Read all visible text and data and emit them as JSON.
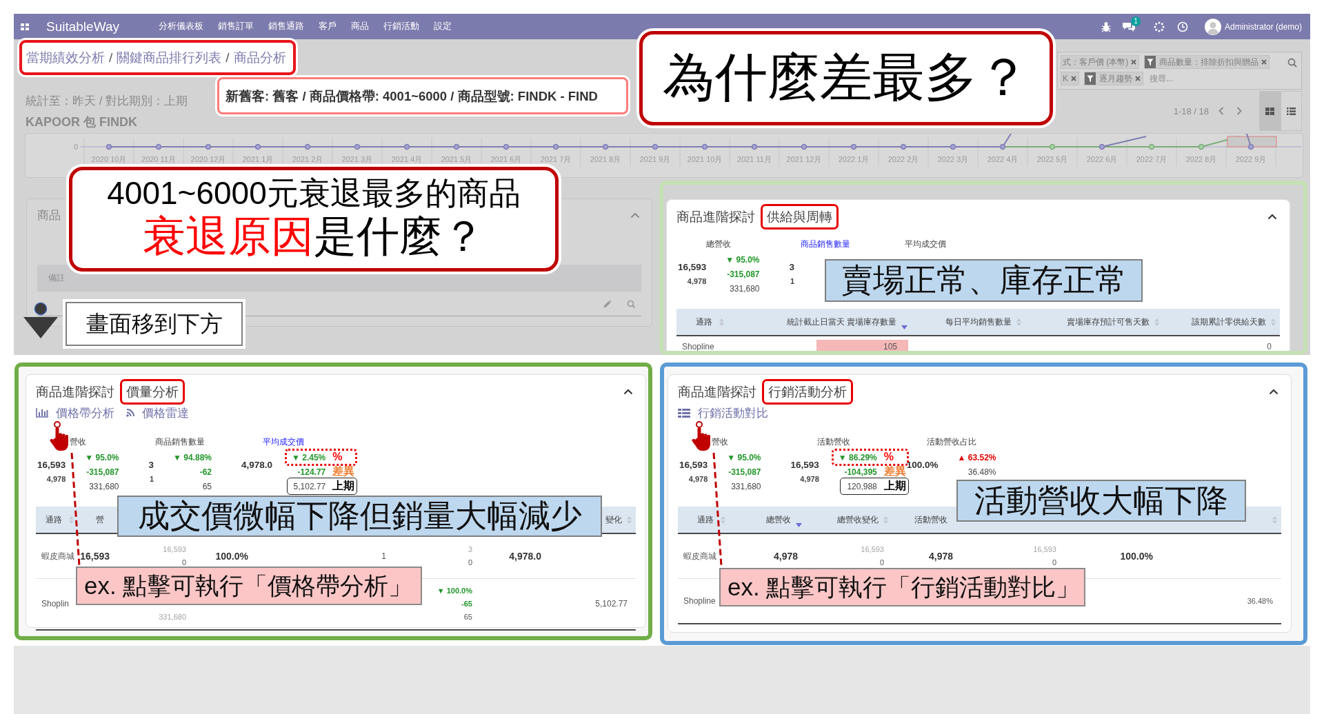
{
  "nav": {
    "brand": "SuitableWay",
    "menu": [
      "分析儀表板",
      "銷售訂單",
      "銷售通路",
      "客戶",
      "商品",
      "行銷活動",
      "設定"
    ],
    "message_count": "1",
    "user": "Administrator (demo)"
  },
  "breadcrumb": [
    {
      "kind": "link",
      "text": "當期績效分析"
    },
    {
      "kind": "separator",
      "text": "/"
    },
    {
      "kind": "link",
      "text": "關鍵商品排行列表"
    },
    {
      "kind": "separator",
      "text": "/"
    },
    {
      "kind": "link",
      "text": "商品分析"
    }
  ],
  "period": "統計至：昨天 / 對比期別：上期",
  "filter_callout": "新舊客: 舊客 / 商品價格帶: 4001~6000 / 商品型號: FINDK - FIND",
  "record_title": "KAPOOR 包 FINDK",
  "question_callout": "為什麼差最多？",
  "search": {
    "facets": [
      {
        "text": "式：客戶價 (本幣)",
        "filter_icon": false
      },
      {
        "text": "商品數量：排除折扣與贈品",
        "filter_icon": true
      },
      {
        "text": "K",
        "filter_icon": false
      },
      {
        "text": "逐月趨勢",
        "filter_icon": true
      }
    ],
    "placeholder": "搜尋..."
  },
  "pager": "1-18 / 18",
  "views": [
    {
      "kind": "kanban",
      "selected": true
    },
    {
      "kind": "list",
      "selected": false
    }
  ],
  "trend_chart": {
    "y_tick": "0",
    "x_labels": [
      "2020 10月",
      "2020 11月",
      "2020 12月",
      "2021 1月",
      "2021 2月",
      "2021 3月",
      "2021 4月",
      "2021 5月",
      "2021 6月",
      "2021 7月",
      "2021 8月",
      "2021 9月",
      "2021 10月",
      "2021 11月",
      "2021 12月",
      "2022 1月",
      "2022 2月",
      "2022 3月",
      "2022 4月",
      "2022 5月",
      "2022 6月",
      "2022 7月",
      "2022 8月",
      "2022 9月"
    ]
  },
  "decline_callout": {
    "line_1": "4001~6000元衰退最多的商品",
    "line_2_highlight": "衰退原因",
    "line_2_rest": "是什麼？"
  },
  "detail_card": {
    "title": "商品",
    "column": "備註"
  },
  "scroll_callout": "畫面移到下方",
  "panels": [
    {
      "color": "#c5e0b4",
      "title": "商品進階探討",
      "section": "供給與周轉",
      "kpis": [
        {
          "label": "總營收",
          "selected": false,
          "value": "16,593",
          "sub_value": "4,978",
          "lines": [
            {
              "text": "▼ 95.0%",
              "kind": "down"
            },
            {
              "text": "-315,087",
              "kind": "down"
            },
            {
              "text": "331,680",
              "kind": "plain"
            }
          ]
        },
        {
          "label": "商品銷售數量",
          "selected": true,
          "value": "3",
          "sub_value": "1"
        },
        {
          "label": "平均成交價",
          "selected": false
        }
      ],
      "callout": "賣場正常、庫存正常",
      "table": {
        "header": {
          "column_1": {
            "label": "通路",
            "sortable": true,
            "sorted": false
          },
          "column_2": {
            "label": "統計截止日當天 賣場庫存數量",
            "sorted": true
          },
          "column_3": {
            "label": "每日平均銷售數量",
            "sortable": true,
            "sorted": false
          },
          "column_4": {
            "label": "賣場庫存預計可售天數",
            "sortable": true,
            "sorted": false
          },
          "column_5": {
            "label": "該期累計零供給天數",
            "sortable": true,
            "sorted": false
          }
        },
        "rows": [
          {
            "column_1": [
              {
                "text": "Shopline",
                "kind": "plain"
              }
            ],
            "column_2": [
              {
                "text": "105",
                "kind": "bar"
              }
            ],
            "column_5": [
              {
                "text": "0",
                "kind": "plain"
              }
            ]
          }
        ]
      }
    },
    {
      "color": "#70ad47",
      "title": "商品進階探討",
      "section": "價量分析",
      "links": [
        {
          "kind": "bars",
          "label": "價格帶分析",
          "pointed": true
        },
        {
          "kind": "feed",
          "label": "價格雷達",
          "pointed": false
        }
      ],
      "kpis": [
        {
          "label": "營收",
          "selected": false,
          "value": "16,593",
          "sub_value": "4,978",
          "lines": [
            {
              "text": "▼ 95.0%",
              "kind": "down"
            },
            {
              "text": "-315,087",
              "kind": "down"
            },
            {
              "text": "331,680",
              "kind": "plain"
            }
          ]
        },
        {
          "label": "商品銷售數量",
          "selected": false,
          "value": "3",
          "sub_value": "1",
          "lines": [
            {
              "text": "▼ 94.88%",
              "kind": "down"
            },
            {
              "text": "-62",
              "kind": "down"
            },
            {
              "text": "65",
              "kind": "plain"
            }
          ]
        },
        {
          "label": "平均成交價",
          "selected": true,
          "value": "4,978.0",
          "lines": [
            {
              "text": "▼ 2.45%",
              "kind": "down",
              "frame": {
                "kind": "dotted"
              },
              "note": {
                "text": "%",
                "color": "#ff0000"
              }
            },
            {
              "text": "-124.77",
              "kind": "down",
              "note": {
                "text": "差異",
                "color": "#ed7d31"
              }
            },
            {
              "text": "5,102.77",
              "kind": "plain",
              "frame": {
                "kind": "solid"
              },
              "note": {
                "text": "上期",
                "color": "#000000"
              }
            }
          ]
        }
      ],
      "callout": "成交價微幅下降但銷量大幅減少",
      "table": {
        "header": {
          "column_1": {
            "label": "通路",
            "sortable": true,
            "sorted": false
          },
          "column_2": {
            "label": "營"
          },
          "column_8": {
            "label": "變化",
            "sortable": true,
            "sorted": false
          }
        },
        "rows": [
          {
            "column_1": [
              {
                "text": "蝦皮商城",
                "kind": "plain"
              }
            ],
            "column_2": [
              {
                "text": "16,593",
                "kind": "strong"
              }
            ],
            "column_3": [
              {
                "text": "16,593",
                "kind": "faint"
              },
              {
                "text": "0",
                "kind": "small"
              }
            ],
            "column_4": [
              {
                "text": "100.0%",
                "kind": "strong"
              }
            ],
            "column_5": [
              {
                "text": "1",
                "kind": "plain"
              }
            ],
            "column_6": [
              {
                "text": "3",
                "kind": "faint"
              },
              {
                "text": "0",
                "kind": "small"
              }
            ],
            "column_7": [
              {
                "text": "4,978.0",
                "kind": "strong"
              }
            ]
          },
          {
            "column_1": [
              {
                "text": "Shoplin",
                "kind": "plain"
              }
            ],
            "column_3": [
              {
                "text": "331,680",
                "kind": "faint"
              }
            ],
            "column_6": [
              {
                "text": "▼ 100.0%",
                "kind": "down"
              },
              {
                "text": "-65",
                "kind": "down"
              },
              {
                "text": "65",
                "kind": "small"
              }
            ],
            "column_8": [
              {
                "text": "5,102.77",
                "kind": "plain"
              }
            ]
          }
        ]
      },
      "hint": "ex. 點擊可執行「價格帶分析」"
    },
    {
      "color": "#5b9bd5",
      "title": "商品進階探討",
      "section": "行銷活動分析",
      "links": [
        {
          "kind": "list",
          "label": "行銷活動對比",
          "pointed": true
        }
      ],
      "kpis": [
        {
          "label": "營收",
          "selected": false,
          "value": "16,593",
          "sub_value": "4,978",
          "lines": [
            {
              "text": "▼ 95.0%",
              "kind": "down"
            },
            {
              "text": "-315,087",
              "kind": "down"
            },
            {
              "text": "331,680",
              "kind": "plain"
            }
          ]
        },
        {
          "label": "活動營收",
          "selected": false,
          "value": "16,593",
          "sub_value": "4,978",
          "lines": [
            {
              "text": "▼ 86.29%",
              "kind": "down",
              "frame": {
                "kind": "dotted"
              },
              "note": {
                "text": "%",
                "color": "#ff0000"
              }
            },
            {
              "text": "-104,395",
              "kind": "down",
              "note": {
                "text": "差異",
                "color": "#ed7d31"
              }
            },
            {
              "text": "120,988",
              "kind": "plain",
              "frame": {
                "kind": "solid"
              },
              "note": {
                "text": "上期",
                "color": "#000000"
              }
            }
          ]
        },
        {
          "label": "活動營收占比",
          "selected": false,
          "value": "100.0%",
          "lines": [
            {
              "text": "▲ 63.52%",
              "kind": "up"
            },
            {
              "text": "36.48%",
              "kind": "plain"
            }
          ]
        }
      ],
      "callout": "活動營收大幅下降",
      "table": {
        "header": {
          "column_1": {
            "label": "通路",
            "sortable": true,
            "sorted": false
          },
          "column_2": {
            "label": "總營收",
            "sorted": true
          },
          "column_3": {
            "label": "總營收變化",
            "sortable": true,
            "sorted": false
          },
          "column_4": {
            "label": "活動營收"
          },
          "column_8": {
            "sortable": true,
            "sorted": false
          }
        },
        "rows": [
          {
            "column_1": [
              {
                "text": "蝦皮商城",
                "kind": "plain"
              }
            ],
            "column_2": [
              {
                "text": "4,978",
                "kind": "strong"
              }
            ],
            "column_3": [
              {
                "text": "16,593",
                "kind": "faint"
              },
              {
                "text": "0",
                "kind": "small"
              }
            ],
            "column_4": [
              {
                "text": "4,978",
                "kind": "strong"
              }
            ],
            "column_5": [
              {
                "text": "16,593",
                "kind": "faint"
              },
              {
                "text": "0",
                "kind": "small"
              }
            ],
            "column_6": [
              {
                "text": "100.0%",
                "kind": "strong"
              }
            ]
          },
          {
            "column_1": [
              {
                "text": "Shopline",
                "kind": "plain"
              }
            ],
            "column_8": [
              {
                "text": "36.48%",
                "kind": "small"
              }
            ]
          }
        ]
      },
      "hint": "ex. 點擊可執行「行銷活動對比」"
    }
  ]
}
